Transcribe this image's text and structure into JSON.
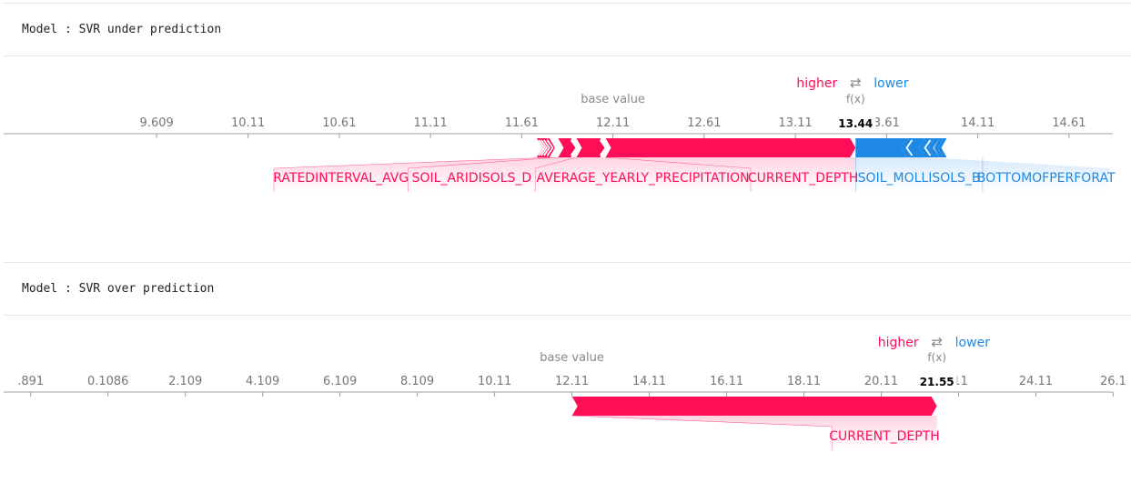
{
  "colors": {
    "positive": "#ff0d57",
    "negative": "#1e88e5",
    "axis": "#a0a0a0",
    "tick_text": "#777777",
    "text": "#000000"
  },
  "panels": [
    {
      "title": "Model : SVR under prediction",
      "chart_data": {
        "type": "force",
        "legend": {
          "higher": "higher",
          "arrows": "⇄",
          "lower": "lower"
        },
        "base_label": "base value",
        "fx_label": "f(x)",
        "base_value": 12.11,
        "output_value": 13.44,
        "output_text": "13.44",
        "xlim": [
          8.87,
          14.85
        ],
        "ticks": [
          9.609,
          10.11,
          10.61,
          11.11,
          11.61,
          12.11,
          12.61,
          13.11,
          13.61,
          14.11,
          14.61
        ],
        "tick_labels": [
          "9.609",
          "10.11",
          "10.61",
          "11.11",
          "11.61",
          "12.11",
          "12.61",
          "13.11",
          "3.61",
          "14.11",
          "14.61"
        ],
        "positive": [
          {
            "name": "",
            "value": 0.012
          },
          {
            "name": "",
            "value": 0.012
          },
          {
            "name": "",
            "value": 0.013
          },
          {
            "name": "",
            "value": 0.015
          },
          {
            "name": "",
            "value": 0.018
          },
          {
            "name": "RATEDINTERVAL_AVG",
            "value": 0.03
          },
          {
            "name": "SOIL_ARIDISOLS_D",
            "value": 0.1
          },
          {
            "name": "AVERAGE_YEARLY_PRECIPITATION",
            "value": 0.16
          },
          {
            "name": "CURRENT_DEPTH",
            "value": 1.37
          }
        ],
        "negative": [
          {
            "name": "SOIL_MOLLISOLS_B",
            "value": 0.28
          },
          {
            "name": "BOTTOMOFPERFORAT",
            "value": 0.1
          },
          {
            "name": "",
            "value": 0.05
          },
          {
            "name": "",
            "value": 0.03
          },
          {
            "name": "",
            "value": 0.02
          },
          {
            "name": "",
            "value": 0.02
          }
        ]
      }
    },
    {
      "title": "Model : SVR over prediction",
      "chart_data": {
        "type": "force",
        "legend": {
          "higher": "higher",
          "arrows": "⇄",
          "lower": "lower"
        },
        "base_label": "base value",
        "fx_label": "f(x)",
        "base_value": 12.11,
        "output_value": 21.55,
        "output_text": "21.55",
        "xlim": [
          -2.12,
          26.1
        ],
        "ticks": [
          -1.891,
          0.1086,
          2.109,
          4.109,
          6.109,
          8.109,
          10.11,
          12.11,
          14.11,
          16.11,
          18.11,
          20.11,
          22.11,
          24.11,
          26.11
        ],
        "tick_labels": [
          ".891",
          "0.1086",
          "2.109",
          "4.109",
          "6.109",
          "8.109",
          "10.11",
          "12.11",
          "14.11",
          "16.11",
          "18.11",
          "20.11",
          ".11",
          "24.11",
          "26.1"
        ],
        "positive": [
          {
            "name": "CURRENT_DEPTH",
            "value": 9.44
          }
        ],
        "negative": []
      }
    }
  ]
}
